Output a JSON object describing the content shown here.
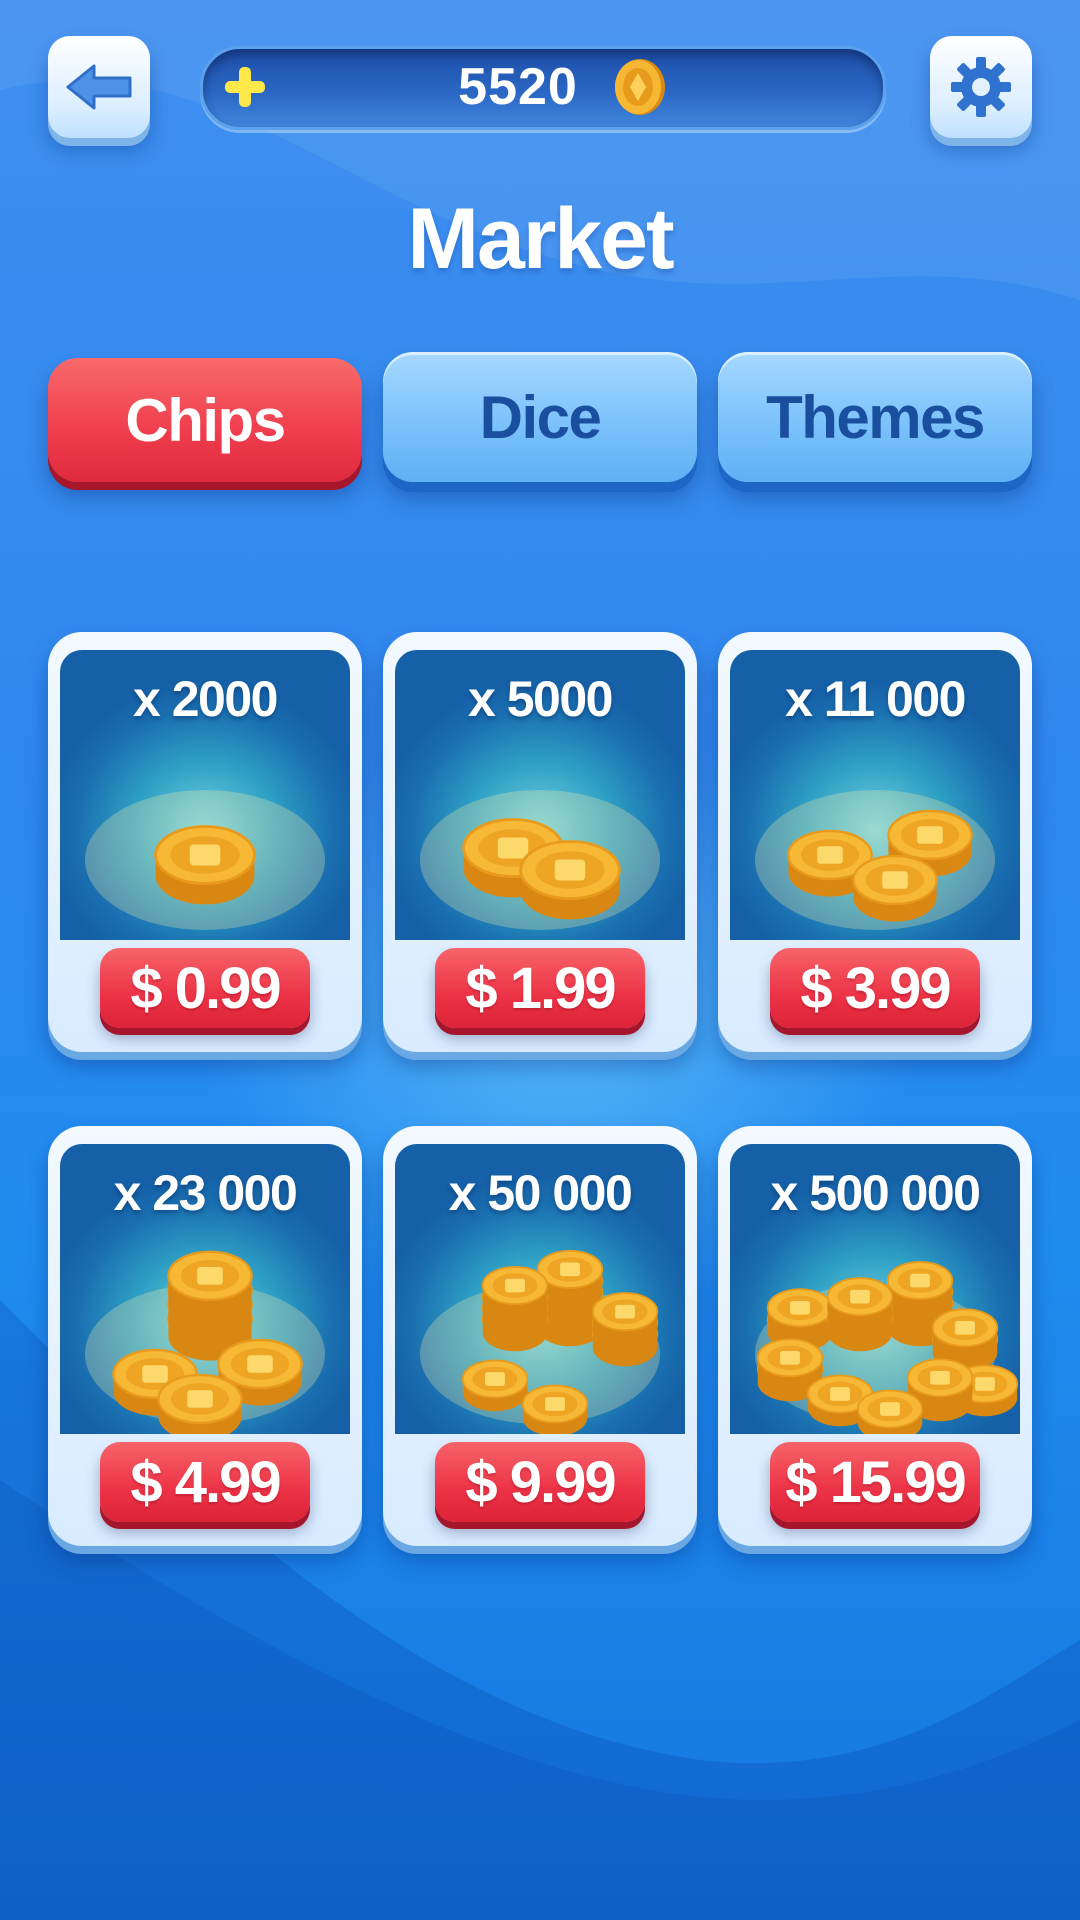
{
  "header": {
    "balance": "5520",
    "title": "Market"
  },
  "tabs": [
    {
      "label": "Chips",
      "active": true
    },
    {
      "label": "Dice",
      "active": false
    },
    {
      "label": "Themes",
      "active": false
    }
  ],
  "products": [
    {
      "quantity": "x 2000",
      "price": "$ 0.99"
    },
    {
      "quantity": "x 5000",
      "price": "$ 1.99"
    },
    {
      "quantity": "x 11 000",
      "price": "$ 3.99"
    },
    {
      "quantity": "x 23 000",
      "price": "$ 4.99"
    },
    {
      "quantity": "x 50 000",
      "price": "$ 9.99"
    },
    {
      "quantity": "x 500 000",
      "price": "$ 15.99"
    }
  ],
  "colors": {
    "background": "#2f88ee",
    "tab_active": "#ef3d4d",
    "tab_inactive": "#7cc2fb",
    "price_button": "#ec3246",
    "coin_gold": "#f5b431"
  },
  "icons": {
    "back": "back-arrow-icon",
    "add_coins": "plus-icon",
    "currency": "coin-icon",
    "settings": "gear-icon"
  }
}
